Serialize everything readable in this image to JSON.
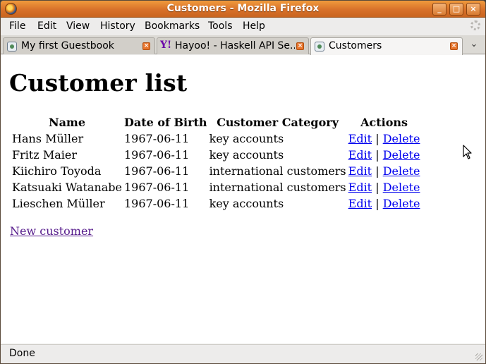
{
  "window": {
    "title": "Customers - Mozilla Firefox",
    "buttons": {
      "minimize": "_",
      "maximize": "□",
      "close": "×"
    }
  },
  "menu": [
    "File",
    "Edit",
    "View",
    "History",
    "Bookmarks",
    "Tools",
    "Help"
  ],
  "tabs": [
    {
      "label": "My first Guestbook",
      "icon": "page-icon",
      "active": false
    },
    {
      "label": "Hayoo! - Haskell API Se...",
      "icon": "yahoo-icon",
      "active": false
    },
    {
      "label": "Customers",
      "icon": "page-icon",
      "active": true
    }
  ],
  "tab_close_glyph": "×",
  "tab_list_glyph": "⌄",
  "page": {
    "title": "Customer list",
    "columns": [
      "Name",
      "Date of Birth",
      "Customer Category",
      "Actions"
    ],
    "rows": [
      {
        "name": "Hans Müller",
        "dob": "1967-06-11",
        "category": "key accounts"
      },
      {
        "name": "Fritz Maier",
        "dob": "1967-06-11",
        "category": "key accounts"
      },
      {
        "name": "Kiichiro Toyoda",
        "dob": "1967-06-11",
        "category": "international customers"
      },
      {
        "name": "Katsuaki Watanabe",
        "dob": "1967-06-11",
        "category": "international customers"
      },
      {
        "name": "Lieschen Müller",
        "dob": "1967-06-11",
        "category": "key accounts"
      }
    ],
    "action_edit": "Edit",
    "action_separator": "|",
    "action_delete": "Delete",
    "new_customer": "New customer"
  },
  "status": {
    "text": "Done"
  },
  "colors": {
    "titlebar": "#e07d2c",
    "link": "#0000ee",
    "visited_link": "#551a8b"
  }
}
